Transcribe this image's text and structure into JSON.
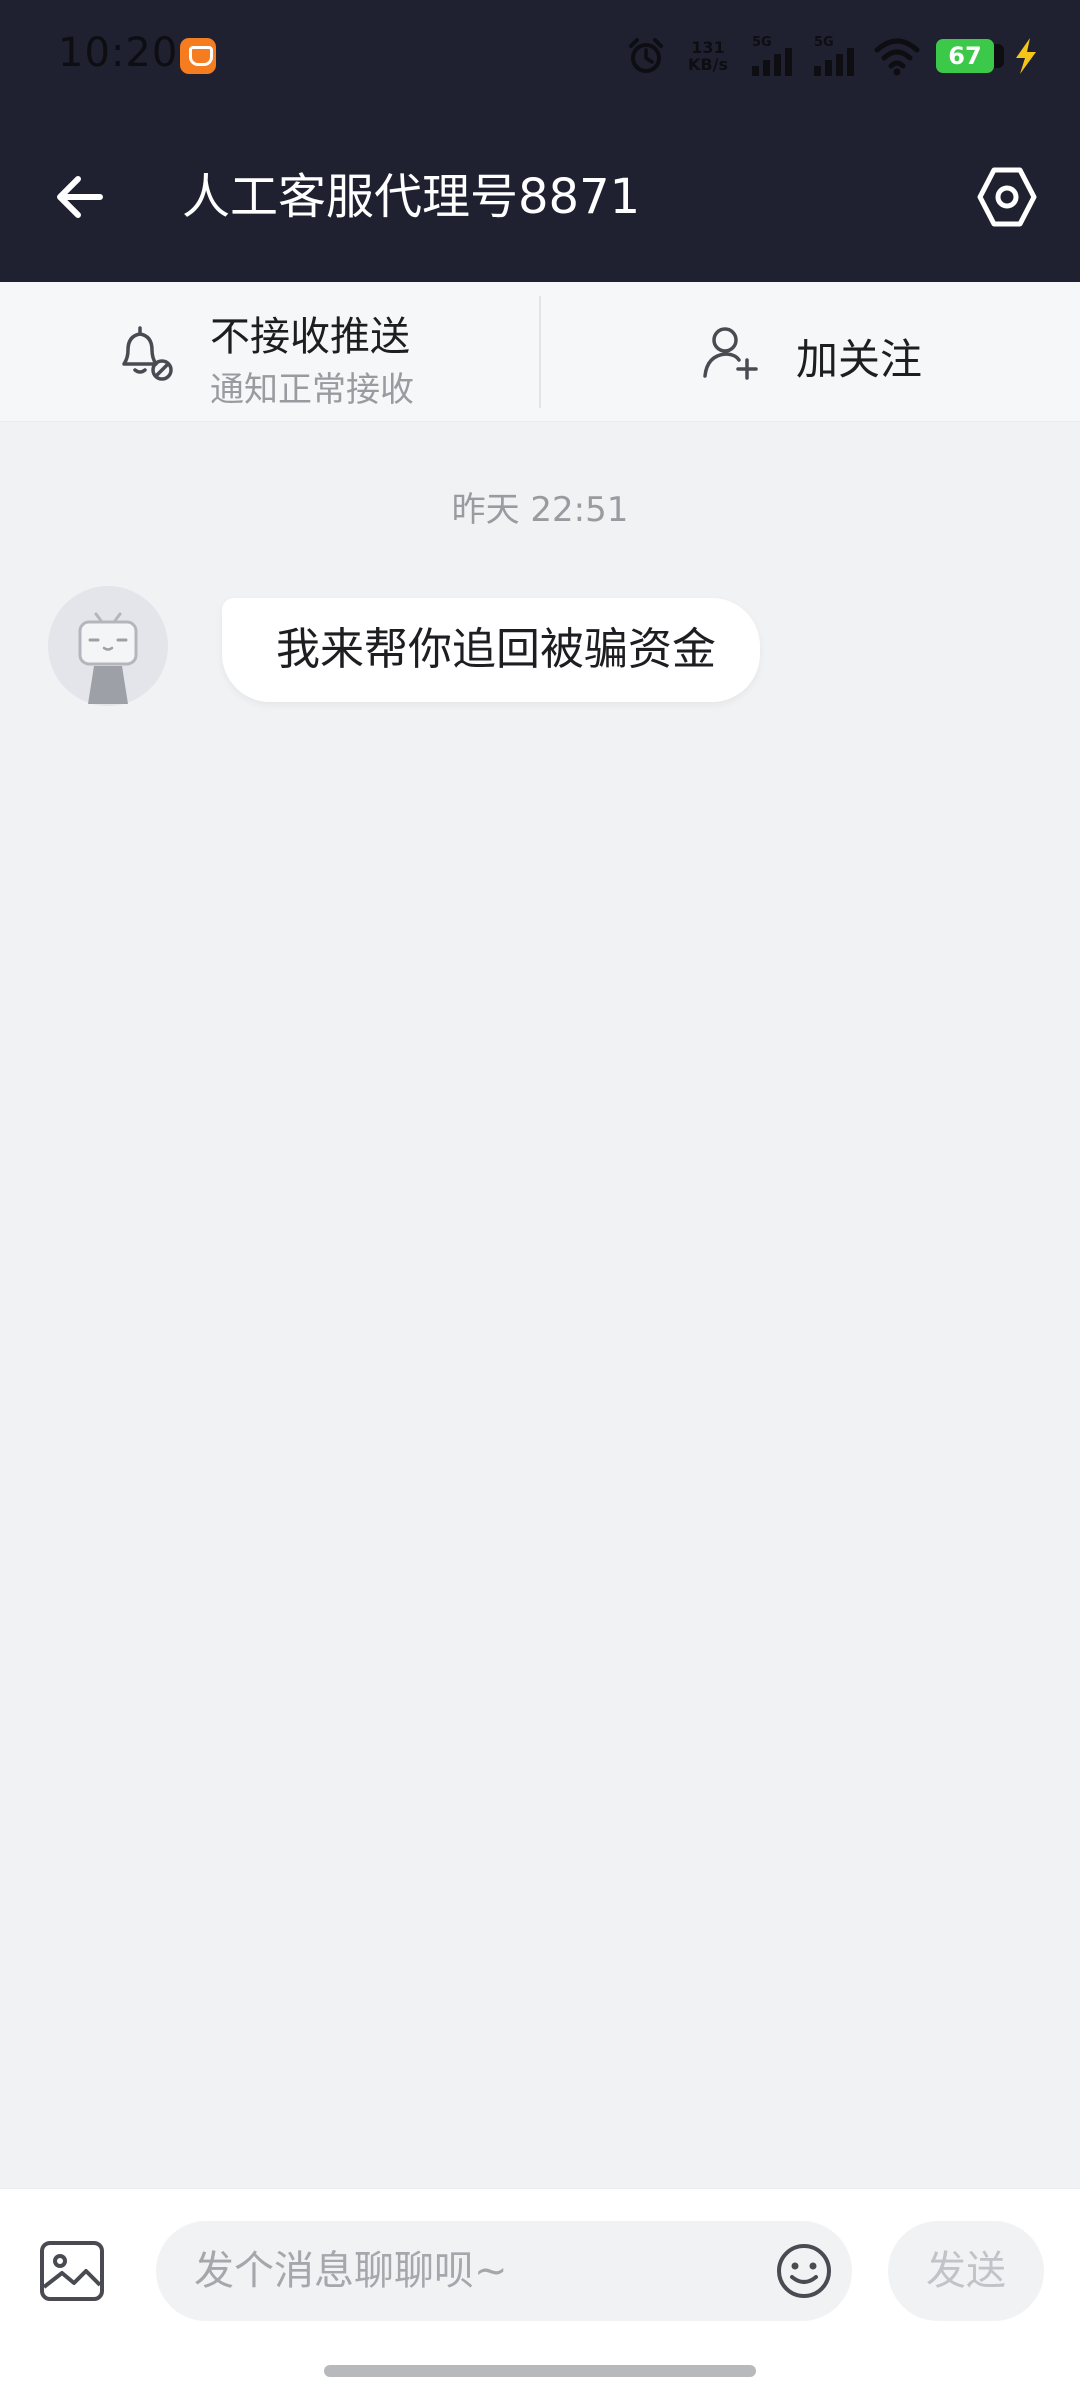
{
  "status_bar": {
    "time": "10:20",
    "net_speed_value": "131",
    "net_speed_unit": "KB/s",
    "sim1_label": "5G",
    "sim2_label": "5G",
    "battery_level": "67",
    "icons": [
      "app-notification-icon",
      "alarm-icon",
      "signal-icon",
      "wifi-icon",
      "battery-icon",
      "charging-icon"
    ]
  },
  "header": {
    "title": "人工客服代理号8871",
    "back_icon": "arrow-left-icon",
    "settings_icon": "settings-hexagon-icon"
  },
  "actions": {
    "push": {
      "title": "不接收推送",
      "subtitle": "通知正常接收",
      "icon": "bell-muted-icon"
    },
    "follow": {
      "label": "加关注",
      "icon": "add-user-icon"
    }
  },
  "chat": {
    "timestamp": "昨天 22:51",
    "messages": [
      {
        "sender": "other",
        "avatar_icon": "tv-mascot-avatar-icon",
        "text": "我来帮你追回被骗资金"
      }
    ]
  },
  "composer": {
    "placeholder": "发个消息聊聊呗~",
    "value": "",
    "send_label": "发送",
    "image_icon": "image-icon",
    "emoji_icon": "emoji-icon"
  },
  "colors": {
    "header_bg": "#1f2131",
    "chat_bg": "#f1f2f4",
    "battery": "#3cc94a",
    "charging": "#f5c518"
  }
}
